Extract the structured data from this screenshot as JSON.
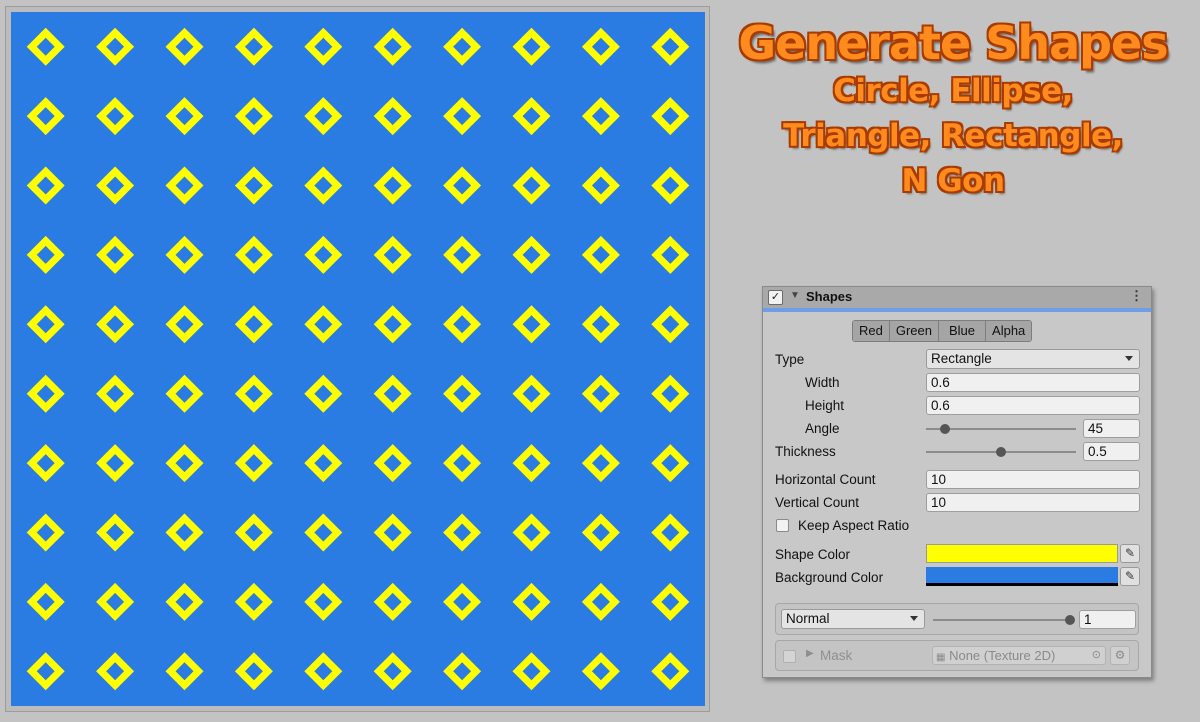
{
  "title": {
    "main": "Generate Shapes",
    "line2": "Circle,  Ellipse,",
    "line3": "Triangle, Rectangle,",
    "line4": "N Gon"
  },
  "preview": {
    "shape": "diamond-outline",
    "horizontal_count": 10,
    "vertical_count": 10,
    "shape_color": "#ffff00",
    "background_color": "#2b7ce2"
  },
  "inspector": {
    "header": {
      "title": "Shapes",
      "enabled": true,
      "fold_icon": "triangle-down-icon",
      "menu_icon": "kebab-menu-icon"
    },
    "channels": [
      "Red",
      "Green",
      "Blue",
      "Alpha"
    ],
    "type": {
      "label": "Type",
      "value": "Rectangle"
    },
    "width": {
      "label": "Width",
      "value": "0.6"
    },
    "height": {
      "label": "Height",
      "value": "0.6"
    },
    "angle": {
      "label": "Angle",
      "value": "45",
      "slider_fraction": 0.125
    },
    "thickness": {
      "label": "Thickness",
      "value": "0.5",
      "slider_fraction": 0.5
    },
    "horizontal_count": {
      "label": "Horizontal Count",
      "value": "10"
    },
    "vertical_count": {
      "label": "Vertical Count",
      "value": "10"
    },
    "keep_aspect": {
      "label": "Keep Aspect Ratio",
      "checked": false
    },
    "shape_color": {
      "label": "Shape Color",
      "color": "#ffff00"
    },
    "background_color": {
      "label": "Background Color",
      "color": "#2b7ce2"
    },
    "blend": {
      "mode": "Normal",
      "value": "1",
      "slider_fraction": 1.0
    },
    "mask": {
      "label": "Mask",
      "enabled": false,
      "texture": "None (Texture 2D)"
    }
  }
}
